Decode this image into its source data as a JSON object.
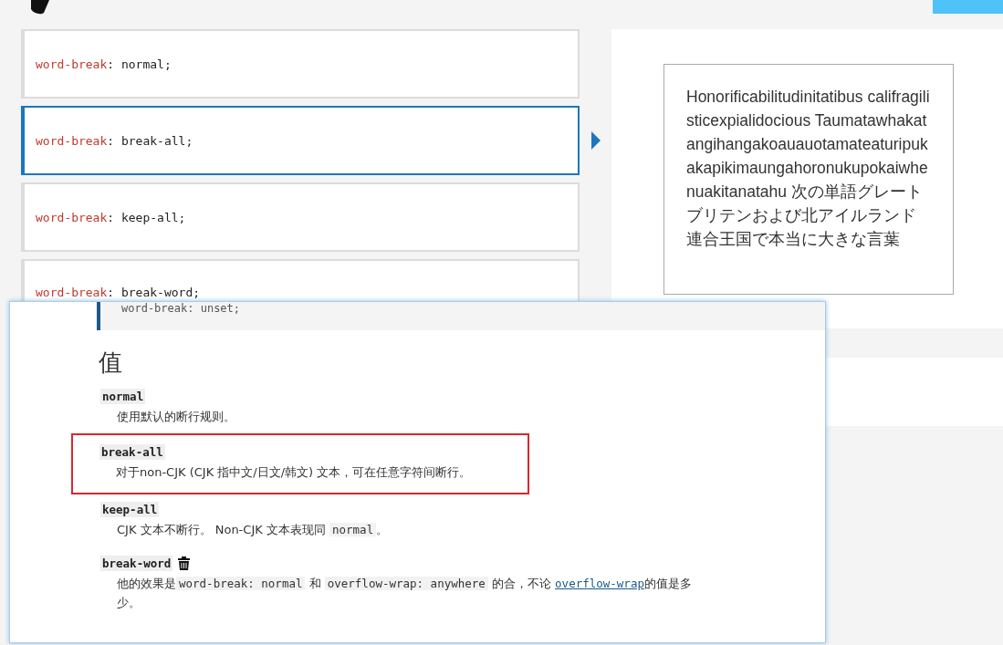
{
  "options": [
    {
      "property": "word-break",
      "separator": ":",
      "value": "normal;",
      "selected": false
    },
    {
      "property": "word-break",
      "separator": ":",
      "value": "break-all;",
      "selected": true
    },
    {
      "property": "word-break",
      "separator": ":",
      "value": "keep-all;",
      "selected": false
    },
    {
      "property": "word-break",
      "separator": ":",
      "value": "break-word;",
      "selected": false
    }
  ],
  "output": {
    "text": "Honorificabilitudinitatibus califragilisticexpialidocious Taumatawhakatangihangakoauauotamateaturipukakapikimaungahoronukupokaiwhenuakitanatahu 次の単語グレートブリテンおよび北アイルランド連合王国で本当に大きな言葉"
  },
  "doc": {
    "code": "word-break: unset;",
    "heading": "值",
    "values": [
      {
        "term": "normal",
        "deprecated": false,
        "highlighted": false,
        "description": [
          {
            "kind": "text",
            "text": "使用默认的断行规则。"
          }
        ]
      },
      {
        "term": "break-all",
        "deprecated": false,
        "highlighted": true,
        "description": [
          {
            "kind": "text",
            "text": "对于non-CJK (CJK 指中文/日文/韩文) 文本，可在任意字符间断行。"
          }
        ]
      },
      {
        "term": "keep-all",
        "deprecated": false,
        "highlighted": false,
        "description": [
          {
            "kind": "text",
            "text": "CJK 文本不断行。 Non-CJK 文本表现同 "
          },
          {
            "kind": "code",
            "text": "normal"
          },
          {
            "kind": "text",
            "text": "。"
          }
        ]
      },
      {
        "term": "break-word",
        "deprecated": true,
        "highlighted": false,
        "description": [
          {
            "kind": "text",
            "text": "他的效果是"
          },
          {
            "kind": "code",
            "text": "word-break: normal"
          },
          {
            "kind": "text",
            "text": " 和 "
          },
          {
            "kind": "code",
            "text": "overflow-wrap: anywhere"
          },
          {
            "kind": "text",
            "text": " 的合，不论 "
          },
          {
            "kind": "link",
            "text": "overflow-wrap"
          },
          {
            "kind": "text",
            "text": "的值是多少。"
          }
        ]
      }
    ]
  }
}
